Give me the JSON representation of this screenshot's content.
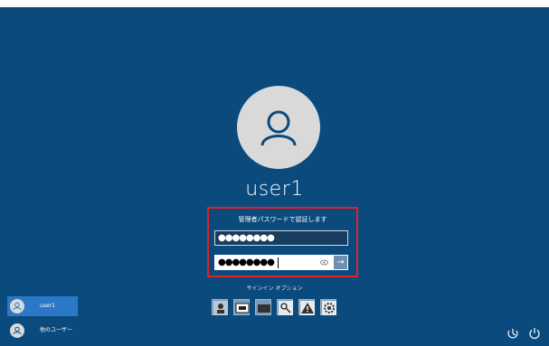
{
  "login": {
    "username": "user1",
    "prompt": "管理者パスワードで認証します",
    "field1_value": "●●●●●●●●",
    "field2_value": "●●●●●●●●",
    "submit_glyph": "→",
    "signin_options_label": "サインイン オプション",
    "signin_options": [
      {
        "icon": "face-icon"
      },
      {
        "icon": "pin-icon"
      },
      {
        "icon": "card-icon"
      },
      {
        "icon": "key-icon"
      },
      {
        "icon": "warning-icon"
      },
      {
        "icon": "gear-icon"
      }
    ]
  },
  "users": [
    {
      "name": "user1",
      "selected": true
    },
    {
      "name": "他のユーザー",
      "selected": false
    }
  ],
  "corner": {
    "left_icon": "accessibility-icon",
    "right_icon": "power-icon"
  },
  "colors": {
    "background": "#0b4a7c",
    "highlight_border": "#e02222",
    "selected_user": "#2a78c7"
  }
}
